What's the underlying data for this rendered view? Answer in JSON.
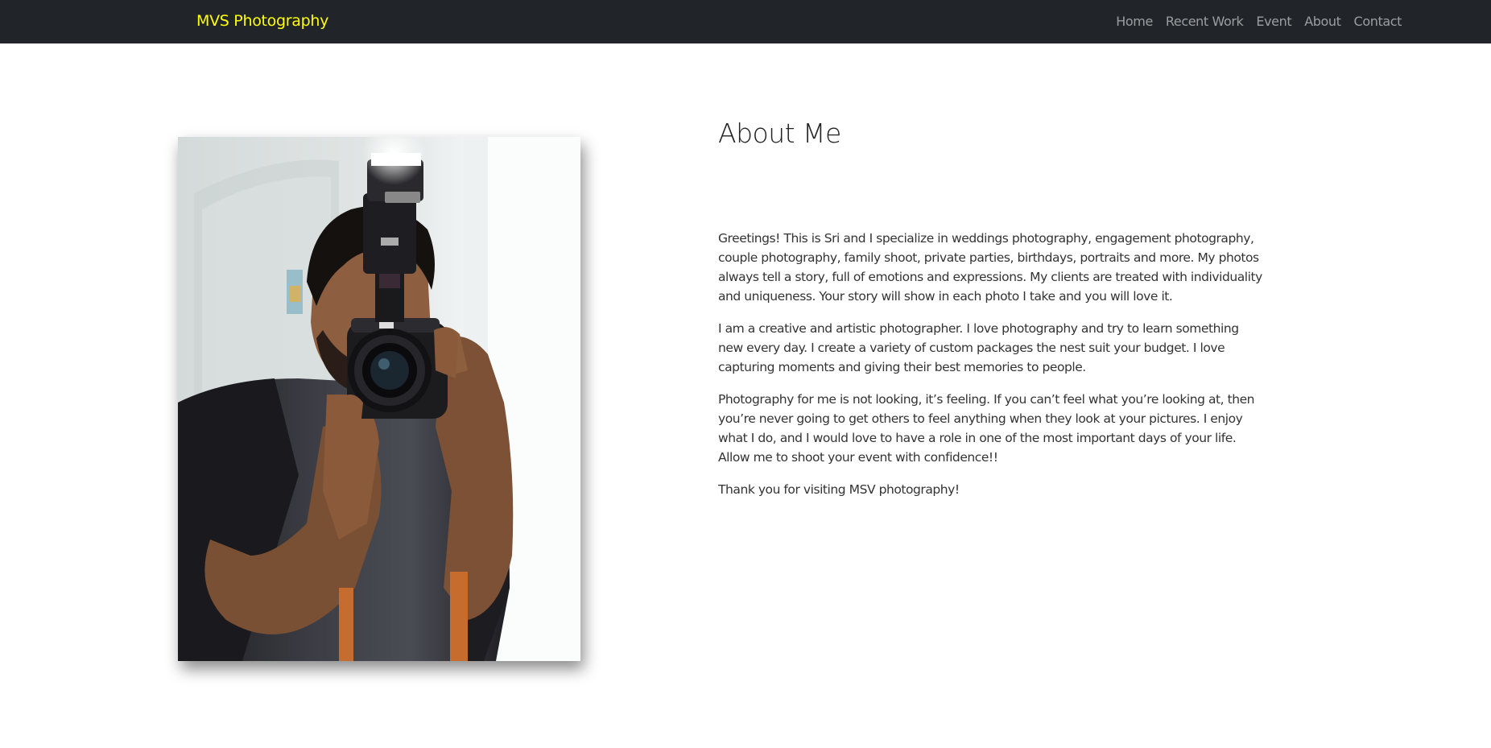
{
  "nav": {
    "brand": "MVS Photography",
    "links": [
      "Home",
      "Recent Work",
      "Event",
      "About",
      "Contact"
    ]
  },
  "about": {
    "title": "About Me",
    "paragraphs": [
      "Greetings! This is Sri and I specialize in weddings photography, engagement photography, couple photography, family shoot, private parties, birthdays, portraits and more. My photos always tell a story, full of emotions and expressions. My clients are treated with individuality and uniqueness. Your story will show in each photo I take and you will love it.",
      "I am a creative and artistic photographer. I love photography and try to learn something new every day. I create a variety of custom packages the nest suit your budget. I love capturing moments and giving their best memories to people.",
      "Photography for me is not looking, it’s feeling. If you can’t feel what you’re looking at, then you’re never going to get others to feel anything when they look at your pictures. I enjoy what I do, and I would love to have a role in one of the most important days of your life. Allow me to shoot your event with confidence!!",
      "Thank you for visiting MSV photography!"
    ]
  },
  "photo": {
    "subject": "photographer holding camera with flash"
  },
  "colors": {
    "navbar_bg": "#212529",
    "brand": "#ffff00",
    "nav_link": "#8c8f92"
  }
}
